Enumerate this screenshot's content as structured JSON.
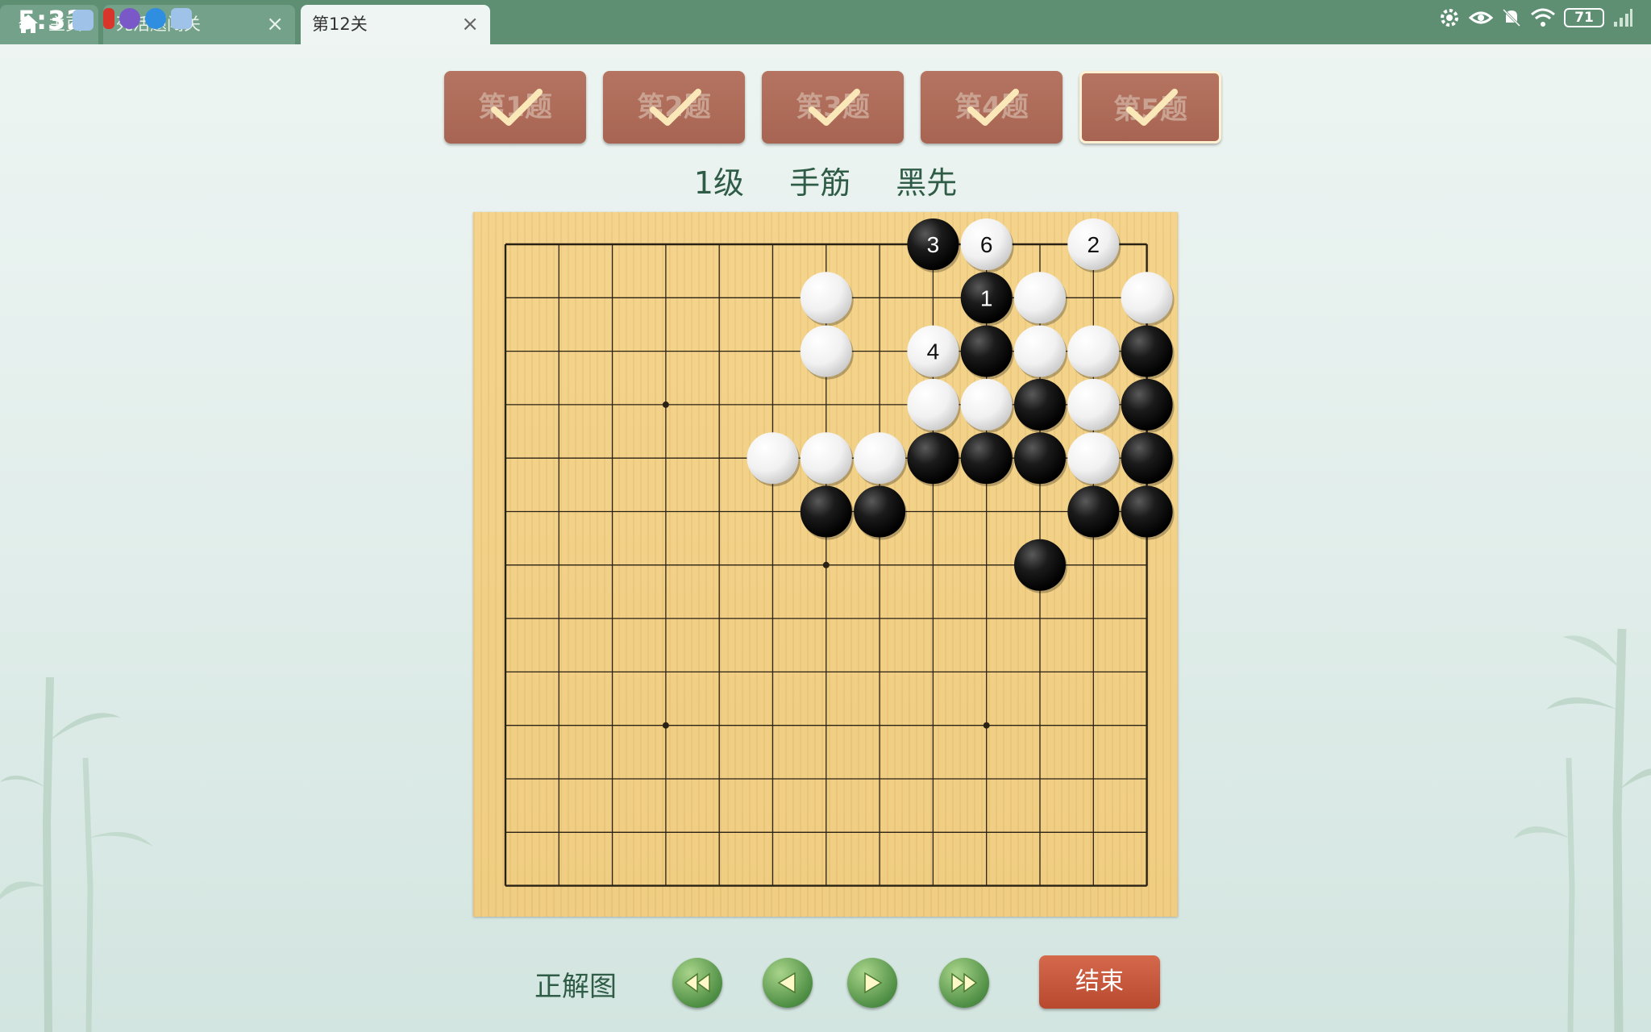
{
  "status_bar": {
    "time": "5:32",
    "battery": "71"
  },
  "tabs": [
    {
      "label": "主页",
      "close": ""
    },
    {
      "label": "死活题闯关",
      "close": "×"
    },
    {
      "label": "第12关",
      "close": "×"
    }
  ],
  "questions": [
    {
      "label": "第1题",
      "solved": true
    },
    {
      "label": "第2题",
      "solved": true
    },
    {
      "label": "第3题",
      "solved": true
    },
    {
      "label": "第4题",
      "solved": true
    },
    {
      "label": "第5题",
      "solved": true,
      "current": true
    }
  ],
  "problem": {
    "level": "1级",
    "category": "手筋",
    "turn": "黑先"
  },
  "board": {
    "size": 13,
    "hoshi": [
      [
        3,
        3
      ],
      [
        6,
        6
      ],
      [
        3,
        9
      ],
      [
        9,
        9
      ]
    ],
    "stones": [
      {
        "c": "b",
        "x": 8,
        "y": 0,
        "n": "3"
      },
      {
        "c": "w",
        "x": 9,
        "y": 0,
        "n": "6"
      },
      {
        "c": "w",
        "x": 11,
        "y": 0,
        "n": "2"
      },
      {
        "c": "w",
        "x": 6,
        "y": 1
      },
      {
        "c": "b",
        "x": 9,
        "y": 1,
        "n": "1"
      },
      {
        "c": "w",
        "x": 10,
        "y": 1
      },
      {
        "c": "w",
        "x": 12,
        "y": 1
      },
      {
        "c": "w",
        "x": 6,
        "y": 2
      },
      {
        "c": "w",
        "x": 8,
        "y": 2,
        "n": "4"
      },
      {
        "c": "b",
        "x": 9,
        "y": 2
      },
      {
        "c": "w",
        "x": 10,
        "y": 2
      },
      {
        "c": "w",
        "x": 11,
        "y": 2
      },
      {
        "c": "b",
        "x": 12,
        "y": 2
      },
      {
        "c": "w",
        "x": 8,
        "y": 3
      },
      {
        "c": "w",
        "x": 9,
        "y": 3
      },
      {
        "c": "b",
        "x": 10,
        "y": 3
      },
      {
        "c": "w",
        "x": 11,
        "y": 3
      },
      {
        "c": "b",
        "x": 12,
        "y": 3
      },
      {
        "c": "w",
        "x": 5,
        "y": 4
      },
      {
        "c": "w",
        "x": 6,
        "y": 4
      },
      {
        "c": "w",
        "x": 7,
        "y": 4
      },
      {
        "c": "b",
        "x": 8,
        "y": 4
      },
      {
        "c": "b",
        "x": 9,
        "y": 4
      },
      {
        "c": "b",
        "x": 10,
        "y": 4
      },
      {
        "c": "w",
        "x": 11,
        "y": 4
      },
      {
        "c": "b",
        "x": 12,
        "y": 4
      },
      {
        "c": "b",
        "x": 6,
        "y": 5
      },
      {
        "c": "b",
        "x": 7,
        "y": 5
      },
      {
        "c": "b",
        "x": 11,
        "y": 5
      },
      {
        "c": "b",
        "x": 12,
        "y": 5
      },
      {
        "c": "b",
        "x": 10,
        "y": 6
      }
    ]
  },
  "controls": {
    "solution_label": "正解图",
    "nav": [
      "first-move",
      "prev-move",
      "next-move",
      "last-move"
    ],
    "end_label": "结束"
  },
  "colors": {
    "topbar": "#5e8f73",
    "button_brown": "#a76452",
    "end_button": "#c4553a",
    "nav_green": "#4f8f45",
    "board": "#f2d187"
  }
}
